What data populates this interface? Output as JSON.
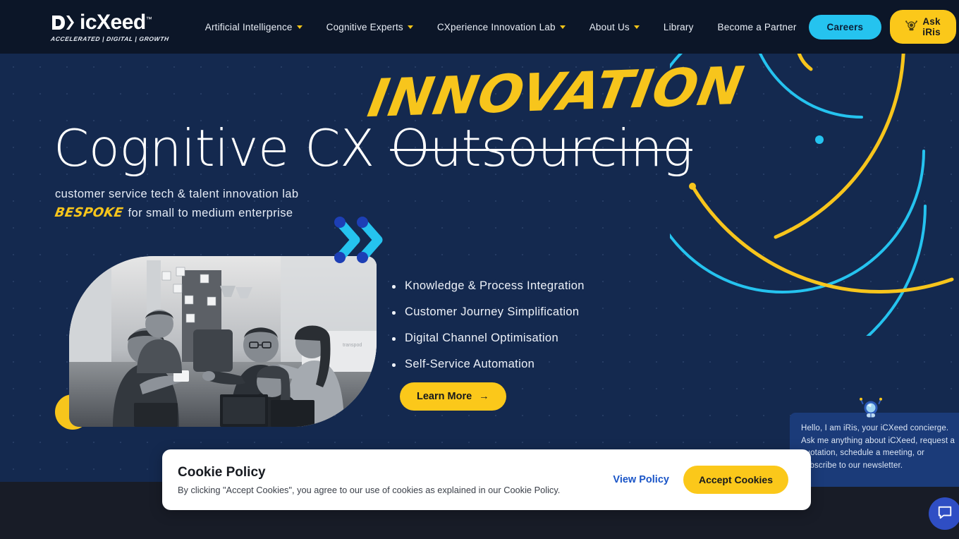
{
  "brand": {
    "name": "icXeed",
    "tm": "™",
    "tagline": "ACCELERATED | DIGITAL | GROWTH"
  },
  "nav": {
    "items": [
      {
        "label": "Artificial Intelligence",
        "has_dropdown": true
      },
      {
        "label": "Cognitive Experts",
        "has_dropdown": true
      },
      {
        "label": "CXperience Innovation Lab",
        "has_dropdown": true
      },
      {
        "label": "About Us",
        "has_dropdown": true
      },
      {
        "label": "Library",
        "has_dropdown": false
      },
      {
        "label": "Become a Partner",
        "has_dropdown": false
      }
    ],
    "careers_label": "Careers",
    "iris_label": "Ask iRis",
    "iris_icon": "robot-icon"
  },
  "hero": {
    "innovation_word": "INNOVATION",
    "title_plain": "Cognitive CX ",
    "title_strike": "Outsourcing",
    "subtitle_line1": "customer service tech & talent innovation lab",
    "subtitle_bespoke": "BESPOKE",
    "subtitle_line2": "for small to medium enterprise",
    "bullets": [
      "Knowledge & Process Integration",
      "Customer Journey Simplification",
      "Digital Channel Optimisation",
      "Self-Service Automation"
    ],
    "learn_more_label": "Learn More",
    "learn_more_arrow": "→"
  },
  "iris_widget": {
    "message": "Hello, I am iRis, your iCXeed concierge. Ask me anything about iCXeed, request a quotation, schedule a meeting, or subscribe to our newsletter.",
    "avatar_icon": "astronaut-avatar-icon",
    "launcher_icon": "chat-bubble-icon"
  },
  "cookie": {
    "title": "Cookie Policy",
    "body": "By clicking \"Accept Cookies\", you agree to our use of cookies as explained in our Cookie Policy.",
    "view_policy_label": "View Policy",
    "accept_label": "Accept Cookies"
  },
  "colors": {
    "header_bg": "#0c1628",
    "hero_bg": "#14294f",
    "page_bg": "#181c27",
    "accent_yellow": "#f7c51c",
    "accent_cyan": "#25c3ef",
    "button_yellow": "#fbc81a",
    "link_blue": "#1a55c7"
  }
}
